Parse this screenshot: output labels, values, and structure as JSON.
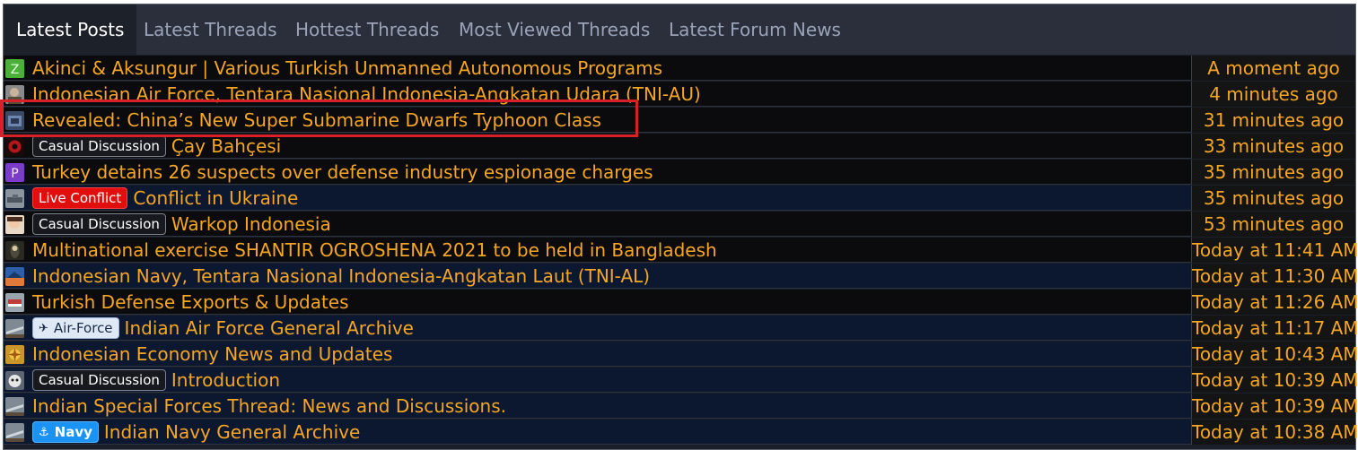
{
  "tabs": [
    {
      "label": "Latest Posts",
      "active": true
    },
    {
      "label": "Latest Threads",
      "active": false
    },
    {
      "label": "Hottest Threads",
      "active": false
    },
    {
      "label": "Most Viewed Threads",
      "active": false
    },
    {
      "label": "Latest Forum News",
      "active": false
    }
  ],
  "rows": [
    {
      "avatar": "letter-z",
      "avatar_letter": "Z",
      "prefix": "",
      "title": "Akinci & Aksungur | Various Turkish Unmanned Autonomous Programs",
      "time": "A moment ago"
    },
    {
      "avatar": "photo",
      "avatar_letter": "",
      "prefix": "",
      "title": "Indonesian Air Force, Tentara Nasional Indonesia-Angkatan Udara (TNI-AU)",
      "time": "4 minutes ago"
    },
    {
      "avatar": "photo",
      "avatar_letter": "",
      "prefix": "",
      "title": "Revealed: China’s New Super Submarine Dwarfs Typhoon Class",
      "time": "31 minutes ago"
    },
    {
      "avatar": "photo",
      "avatar_letter": "",
      "prefix": "Casual Discussion",
      "title": "Çay Bahçesi",
      "time": "33 minutes ago"
    },
    {
      "avatar": "letter-p",
      "avatar_letter": "P",
      "prefix": "",
      "title": "Turkey detains 26 suspects over defense industry espionage charges",
      "time": "35 minutes ago"
    },
    {
      "avatar": "photo",
      "avatar_letter": "",
      "prefix": "Live Conflict",
      "title": "Conflict in Ukraine",
      "time": "35 minutes ago"
    },
    {
      "avatar": "photo",
      "avatar_letter": "",
      "prefix": "Casual Discussion",
      "title": "Warkop Indonesia",
      "time": "53 minutes ago"
    },
    {
      "avatar": "photo",
      "avatar_letter": "",
      "prefix": "",
      "title": "Multinational exercise SHANTIR OGROSHENA 2021 to be held in Bangladesh",
      "time": "Today at 11:41 AM"
    },
    {
      "avatar": "photo",
      "avatar_letter": "",
      "prefix": "",
      "title": "Indonesian Navy, Tentara Nasional Indonesia-Angkatan Laut (TNI-AL)",
      "time": "Today at 11:30 AM"
    },
    {
      "avatar": "photo",
      "avatar_letter": "",
      "prefix": "",
      "title": "Turkish Defense Exports & Updates",
      "time": "Today at 11:26 AM"
    },
    {
      "avatar": "photo",
      "avatar_letter": "",
      "prefix": "Air-Force",
      "title": "Indian Air Force General Archive",
      "time": "Today at 11:17 AM"
    },
    {
      "avatar": "photo",
      "avatar_letter": "",
      "prefix": "",
      "title": "Indonesian Economy News and Updates",
      "time": "Today at 10:43 AM"
    },
    {
      "avatar": "photo",
      "avatar_letter": "",
      "prefix": "Casual Discussion",
      "title": "Introduction",
      "time": "Today at 10:39 AM"
    },
    {
      "avatar": "photo",
      "avatar_letter": "",
      "prefix": "",
      "title": "Indian Special Forces Thread: News and Discussions.",
      "time": "Today at 10:39 AM"
    },
    {
      "avatar": "photo",
      "avatar_letter": "",
      "prefix": "Navy",
      "title": "Indian Navy General Archive",
      "time": "Today at 10:38 AM"
    }
  ],
  "colors": {
    "link": "#f5a623",
    "live_label": "#e10e0e",
    "navy_label": "#1a93f5",
    "highlight_box": "#d72027"
  }
}
